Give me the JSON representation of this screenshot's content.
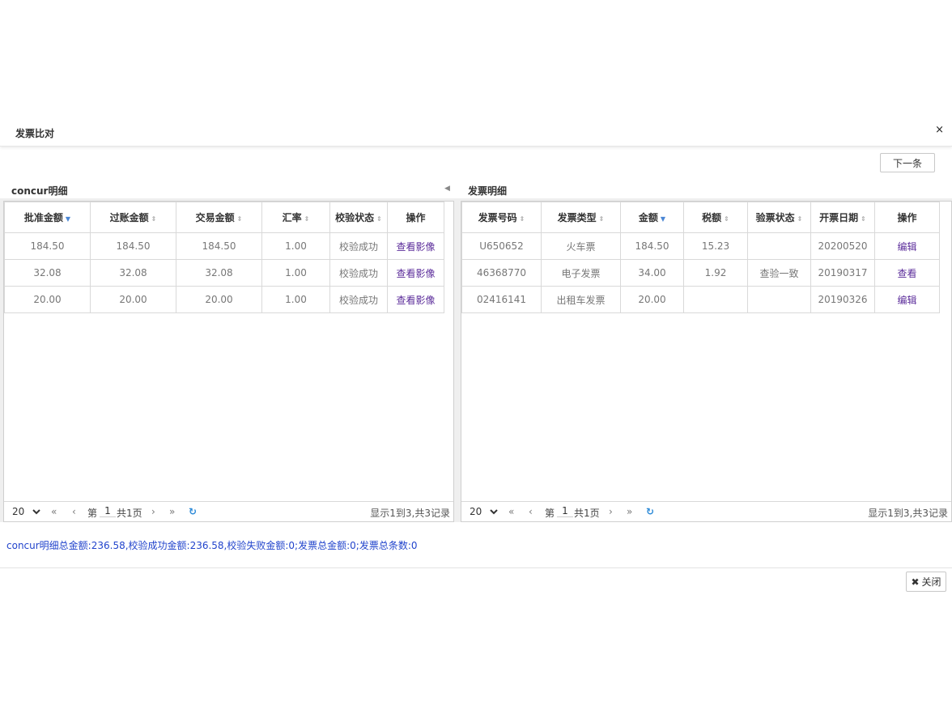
{
  "dialog": {
    "title": "发票比对",
    "close_glyph": "×",
    "next_label": "下一条",
    "close_label": "关闭",
    "summary": "concur明细总金额:236.58,校验成功金额:236.58,校验失败金额:0;发票总金额:0;发票总条数:0"
  },
  "left": {
    "title": "concur明细",
    "columns": [
      "批准金额",
      "过账金额",
      "交易金额",
      "汇率",
      "校验状态",
      "操作"
    ],
    "rows": [
      [
        "184.50",
        "184.50",
        "184.50",
        "1.00",
        "校验成功",
        "查看影像"
      ],
      [
        "32.08",
        "32.08",
        "32.08",
        "1.00",
        "校验成功",
        "查看影像"
      ],
      [
        "20.00",
        "20.00",
        "20.00",
        "1.00",
        "校验成功",
        "查看影像"
      ]
    ],
    "pager": {
      "size": "20",
      "page_prefix": "第",
      "page": "1",
      "page_total": "共1页",
      "info": "显示1到3,共3记录"
    }
  },
  "right": {
    "title": "发票明细",
    "columns": [
      "发票号码",
      "发票类型",
      "金额",
      "税额",
      "验票状态",
      "开票日期",
      "操作"
    ],
    "rows": [
      [
        "U650652",
        "火车票",
        "184.50",
        "15.23",
        "",
        "20200520",
        "编辑"
      ],
      [
        "46368770",
        "电子发票",
        "34.00",
        "1.92",
        "查验一致",
        "20190317",
        "查看"
      ],
      [
        "02416141",
        "出租车发票",
        "20.00",
        "",
        "",
        "20190326",
        "编辑"
      ]
    ],
    "pager": {
      "size": "20",
      "page_prefix": "第",
      "page": "1",
      "page_total": "共1页",
      "info": "显示1到3,共3记录"
    }
  },
  "icons": {
    "sort": "sort-icon",
    "sort_active": "sort-desc-icon",
    "first": "first-page-icon",
    "prev": "prev-page-icon",
    "next": "next-page-icon",
    "last": "last-page-icon",
    "refresh": "refresh-icon",
    "collapse": "collapse-left-icon"
  },
  "colors": {
    "link": "#5b2c9a",
    "summary": "#2244cc",
    "sort_active": "#4a86d4",
    "refresh": "#2e8bd8"
  }
}
